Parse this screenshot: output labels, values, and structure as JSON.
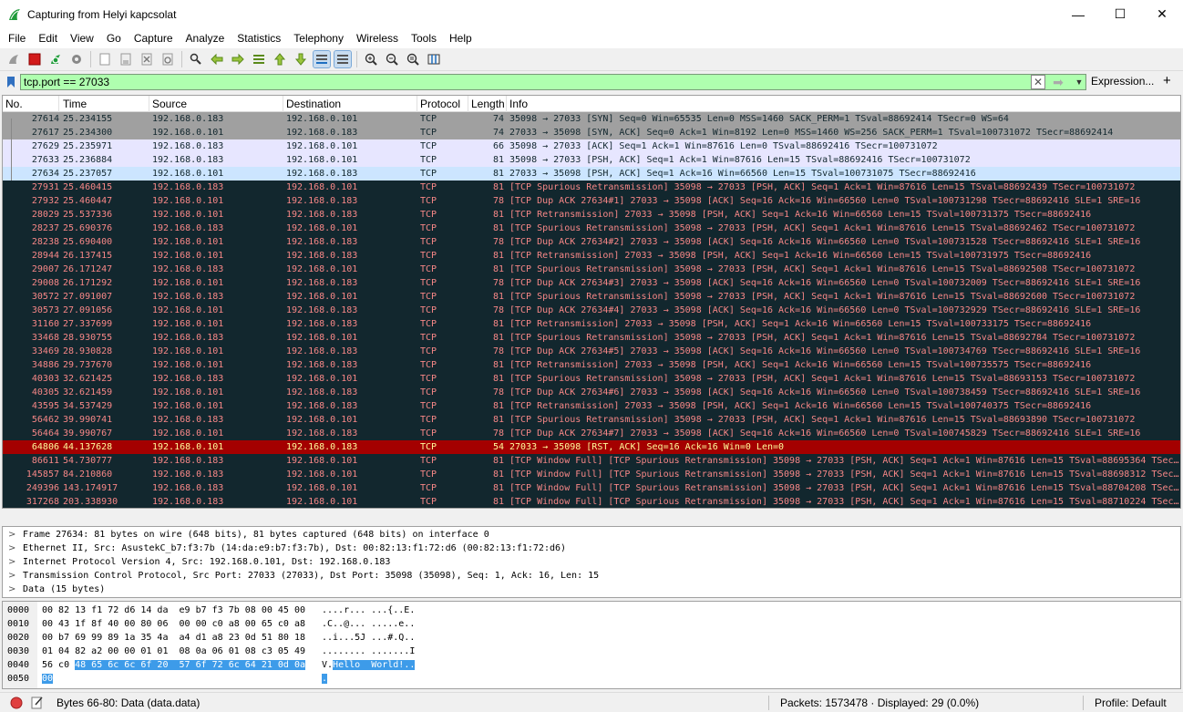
{
  "window": {
    "title": "Capturing from Helyi kapcsolat",
    "minimize": "—",
    "maximize": "☐",
    "close": "✕"
  },
  "menu": [
    "File",
    "Edit",
    "View",
    "Go",
    "Capture",
    "Analyze",
    "Statistics",
    "Telephony",
    "Wireless",
    "Tools",
    "Help"
  ],
  "filter": {
    "value": "tcp.port == 27033",
    "expression_label": "Expression...",
    "add_label": "+"
  },
  "packet_list": {
    "columns": [
      "No.",
      "Time",
      "Source",
      "Destination",
      "Protocol",
      "Length",
      "Info"
    ],
    "rows": [
      {
        "style": "gray",
        "no": "27614",
        "time": "25.234155",
        "src": "192.168.0.183",
        "dst": "192.168.0.101",
        "proto": "TCP",
        "len": "74",
        "info": "35098 → 27033 [SYN] Seq=0 Win=65535 Len=0 MSS=1460 SACK_PERM=1 TSval=88692414 TSecr=0 WS=64"
      },
      {
        "style": "gray",
        "no": "27617",
        "time": "25.234300",
        "src": "192.168.0.101",
        "dst": "192.168.0.183",
        "proto": "TCP",
        "len": "74",
        "info": "27033 → 35098 [SYN, ACK] Seq=0 Ack=1 Win=8192 Len=0 MSS=1460 WS=256 SACK_PERM=1 TSval=100731072 TSecr=88692414"
      },
      {
        "style": "lav",
        "no": "27629",
        "time": "25.235971",
        "src": "192.168.0.183",
        "dst": "192.168.0.101",
        "proto": "TCP",
        "len": "66",
        "info": "35098 → 27033 [ACK] Seq=1 Ack=1 Win=87616 Len=0 TSval=88692416 TSecr=100731072"
      },
      {
        "style": "lav",
        "no": "27633",
        "time": "25.236884",
        "src": "192.168.0.183",
        "dst": "192.168.0.101",
        "proto": "TCP",
        "len": "81",
        "info": "35098 → 27033 [PSH, ACK] Seq=1 Ack=1 Win=87616 Len=15 TSval=88692416 TSecr=100731072"
      },
      {
        "style": "sel",
        "no": "27634",
        "time": "25.237057",
        "src": "192.168.0.101",
        "dst": "192.168.0.183",
        "proto": "TCP",
        "len": "81",
        "info": "27033 → 35098 [PSH, ACK] Seq=1 Ack=16 Win=66560 Len=15 TSval=100731075 TSecr=88692416"
      },
      {
        "style": "dark",
        "no": "27931",
        "time": "25.460415",
        "src": "192.168.0.183",
        "dst": "192.168.0.101",
        "proto": "TCP",
        "len": "81",
        "info": "[TCP Spurious Retransmission] 35098 → 27033 [PSH, ACK] Seq=1 Ack=1 Win=87616 Len=15 TSval=88692439 TSecr=100731072"
      },
      {
        "style": "dark",
        "no": "27932",
        "time": "25.460447",
        "src": "192.168.0.101",
        "dst": "192.168.0.183",
        "proto": "TCP",
        "len": "78",
        "info": "[TCP Dup ACK 27634#1] 27033 → 35098 [ACK] Seq=16 Ack=16 Win=66560 Len=0 TSval=100731298 TSecr=88692416 SLE=1 SRE=16"
      },
      {
        "style": "dark",
        "no": "28029",
        "time": "25.537336",
        "src": "192.168.0.101",
        "dst": "192.168.0.183",
        "proto": "TCP",
        "len": "81",
        "info": "[TCP Retransmission] 27033 → 35098 [PSH, ACK] Seq=1 Ack=16 Win=66560 Len=15 TSval=100731375 TSecr=88692416"
      },
      {
        "style": "dark",
        "no": "28237",
        "time": "25.690376",
        "src": "192.168.0.183",
        "dst": "192.168.0.101",
        "proto": "TCP",
        "len": "81",
        "info": "[TCP Spurious Retransmission] 35098 → 27033 [PSH, ACK] Seq=1 Ack=1 Win=87616 Len=15 TSval=88692462 TSecr=100731072"
      },
      {
        "style": "dark",
        "no": "28238",
        "time": "25.690400",
        "src": "192.168.0.101",
        "dst": "192.168.0.183",
        "proto": "TCP",
        "len": "78",
        "info": "[TCP Dup ACK 27634#2] 27033 → 35098 [ACK] Seq=16 Ack=16 Win=66560 Len=0 TSval=100731528 TSecr=88692416 SLE=1 SRE=16"
      },
      {
        "style": "dark",
        "no": "28944",
        "time": "26.137415",
        "src": "192.168.0.101",
        "dst": "192.168.0.183",
        "proto": "TCP",
        "len": "81",
        "info": "[TCP Retransmission] 27033 → 35098 [PSH, ACK] Seq=1 Ack=16 Win=66560 Len=15 TSval=100731975 TSecr=88692416"
      },
      {
        "style": "dark",
        "no": "29007",
        "time": "26.171247",
        "src": "192.168.0.183",
        "dst": "192.168.0.101",
        "proto": "TCP",
        "len": "81",
        "info": "[TCP Spurious Retransmission] 35098 → 27033 [PSH, ACK] Seq=1 Ack=1 Win=87616 Len=15 TSval=88692508 TSecr=100731072"
      },
      {
        "style": "dark",
        "no": "29008",
        "time": "26.171292",
        "src": "192.168.0.101",
        "dst": "192.168.0.183",
        "proto": "TCP",
        "len": "78",
        "info": "[TCP Dup ACK 27634#3] 27033 → 35098 [ACK] Seq=16 Ack=16 Win=66560 Len=0 TSval=100732009 TSecr=88692416 SLE=1 SRE=16"
      },
      {
        "style": "dark",
        "no": "30572",
        "time": "27.091007",
        "src": "192.168.0.183",
        "dst": "192.168.0.101",
        "proto": "TCP",
        "len": "81",
        "info": "[TCP Spurious Retransmission] 35098 → 27033 [PSH, ACK] Seq=1 Ack=1 Win=87616 Len=15 TSval=88692600 TSecr=100731072"
      },
      {
        "style": "dark",
        "no": "30573",
        "time": "27.091056",
        "src": "192.168.0.101",
        "dst": "192.168.0.183",
        "proto": "TCP",
        "len": "78",
        "info": "[TCP Dup ACK 27634#4] 27033 → 35098 [ACK] Seq=16 Ack=16 Win=66560 Len=0 TSval=100732929 TSecr=88692416 SLE=1 SRE=16"
      },
      {
        "style": "dark",
        "no": "31160",
        "time": "27.337699",
        "src": "192.168.0.101",
        "dst": "192.168.0.183",
        "proto": "TCP",
        "len": "81",
        "info": "[TCP Retransmission] 27033 → 35098 [PSH, ACK] Seq=1 Ack=16 Win=66560 Len=15 TSval=100733175 TSecr=88692416"
      },
      {
        "style": "dark",
        "no": "33468",
        "time": "28.930755",
        "src": "192.168.0.183",
        "dst": "192.168.0.101",
        "proto": "TCP",
        "len": "81",
        "info": "[TCP Spurious Retransmission] 35098 → 27033 [PSH, ACK] Seq=1 Ack=1 Win=87616 Len=15 TSval=88692784 TSecr=100731072"
      },
      {
        "style": "dark",
        "no": "33469",
        "time": "28.930828",
        "src": "192.168.0.101",
        "dst": "192.168.0.183",
        "proto": "TCP",
        "len": "78",
        "info": "[TCP Dup ACK 27634#5] 27033 → 35098 [ACK] Seq=16 Ack=16 Win=66560 Len=0 TSval=100734769 TSecr=88692416 SLE=1 SRE=16"
      },
      {
        "style": "dark",
        "no": "34886",
        "time": "29.737670",
        "src": "192.168.0.101",
        "dst": "192.168.0.183",
        "proto": "TCP",
        "len": "81",
        "info": "[TCP Retransmission] 27033 → 35098 [PSH, ACK] Seq=1 Ack=16 Win=66560 Len=15 TSval=100735575 TSecr=88692416"
      },
      {
        "style": "dark",
        "no": "40303",
        "time": "32.621425",
        "src": "192.168.0.183",
        "dst": "192.168.0.101",
        "proto": "TCP",
        "len": "81",
        "info": "[TCP Spurious Retransmission] 35098 → 27033 [PSH, ACK] Seq=1 Ack=1 Win=87616 Len=15 TSval=88693153 TSecr=100731072"
      },
      {
        "style": "dark",
        "no": "40305",
        "time": "32.621459",
        "src": "192.168.0.101",
        "dst": "192.168.0.183",
        "proto": "TCP",
        "len": "78",
        "info": "[TCP Dup ACK 27634#6] 27033 → 35098 [ACK] Seq=16 Ack=16 Win=66560 Len=0 TSval=100738459 TSecr=88692416 SLE=1 SRE=16"
      },
      {
        "style": "dark",
        "no": "43595",
        "time": "34.537429",
        "src": "192.168.0.101",
        "dst": "192.168.0.183",
        "proto": "TCP",
        "len": "81",
        "info": "[TCP Retransmission] 27033 → 35098 [PSH, ACK] Seq=1 Ack=16 Win=66560 Len=15 TSval=100740375 TSecr=88692416"
      },
      {
        "style": "dark",
        "no": "56462",
        "time": "39.990741",
        "src": "192.168.0.183",
        "dst": "192.168.0.101",
        "proto": "TCP",
        "len": "81",
        "info": "[TCP Spurious Retransmission] 35098 → 27033 [PSH, ACK] Seq=1 Ack=1 Win=87616 Len=15 TSval=88693890 TSecr=100731072"
      },
      {
        "style": "dark",
        "no": "56464",
        "time": "39.990767",
        "src": "192.168.0.101",
        "dst": "192.168.0.183",
        "proto": "TCP",
        "len": "78",
        "info": "[TCP Dup ACK 27634#7] 27033 → 35098 [ACK] Seq=16 Ack=16 Win=66560 Len=0 TSval=100745829 TSecr=88692416 SLE=1 SRE=16"
      },
      {
        "style": "rst",
        "no": "64806",
        "time": "44.137628",
        "src": "192.168.0.101",
        "dst": "192.168.0.183",
        "proto": "TCP",
        "len": "54",
        "info": "27033 → 35098 [RST, ACK] Seq=16 Ack=16 Win=0 Len=0"
      },
      {
        "style": "dark",
        "no": "86611",
        "time": "54.730777",
        "src": "192.168.0.183",
        "dst": "192.168.0.101",
        "proto": "TCP",
        "len": "81",
        "info": "[TCP Window Full] [TCP Spurious Retransmission] 35098 → 27033 [PSH, ACK] Seq=1 Ack=1 Win=87616 Len=15 TSval=88695364 TSec…"
      },
      {
        "style": "dark",
        "no": "145857",
        "time": "84.210860",
        "src": "192.168.0.183",
        "dst": "192.168.0.101",
        "proto": "TCP",
        "len": "81",
        "info": "[TCP Window Full] [TCP Spurious Retransmission] 35098 → 27033 [PSH, ACK] Seq=1 Ack=1 Win=87616 Len=15 TSval=88698312 TSec…"
      },
      {
        "style": "dark",
        "no": "249396",
        "time": "143.174917",
        "src": "192.168.0.183",
        "dst": "192.168.0.101",
        "proto": "TCP",
        "len": "81",
        "info": "[TCP Window Full] [TCP Spurious Retransmission] 35098 → 27033 [PSH, ACK] Seq=1 Ack=1 Win=87616 Len=15 TSval=88704208 TSec…"
      },
      {
        "style": "dark",
        "no": "317268",
        "time": "203.338930",
        "src": "192.168.0.183",
        "dst": "192.168.0.101",
        "proto": "TCP",
        "len": "81",
        "info": "[TCP Window Full] [TCP Spurious Retransmission] 35098 → 27033 [PSH, ACK] Seq=1 Ack=1 Win=87616 Len=15 TSval=88710224 TSec…"
      }
    ]
  },
  "details": [
    "Frame 27634: 81 bytes on wire (648 bits), 81 bytes captured (648 bits) on interface 0",
    "Ethernet II, Src: AsustekC_b7:f3:7b (14:da:e9:b7:f3:7b), Dst: 00:82:13:f1:72:d6 (00:82:13:f1:72:d6)",
    "Internet Protocol Version 4, Src: 192.168.0.101, Dst: 192.168.0.183",
    "Transmission Control Protocol, Src Port: 27033 (27033), Dst Port: 35098 (35098), Seq: 1, Ack: 16, Len: 15",
    "Data (15 bytes)"
  ],
  "bytes": {
    "offsets": [
      "0000",
      "0010",
      "0020",
      "0030",
      "0040",
      "0050"
    ],
    "rows": [
      {
        "hex": "00 82 13 f1 72 d6 14 da  e9 b7 f3 7b 08 00 45 00",
        "hex_hl": "",
        "ascii": "....r... ...{..E.",
        "ascii_hl": ""
      },
      {
        "hex": "00 43 1f 8f 40 00 80 06  00 00 c0 a8 00 65 c0 a8",
        "hex_hl": "",
        "ascii": ".C..@... .....e..",
        "ascii_hl": ""
      },
      {
        "hex": "00 b7 69 99 89 1a 35 4a  a4 d1 a8 23 0d 51 80 18",
        "hex_hl": "",
        "ascii": "..i...5J ...#.Q..",
        "ascii_hl": ""
      },
      {
        "hex": "01 04 82 a2 00 00 01 01  08 0a 06 01 08 c3 05 49",
        "hex_hl": "",
        "ascii": "........ .......I",
        "ascii_hl": ""
      },
      {
        "hex": "56 c0 ",
        "hex_hl": "48 65 6c 6c 6f 20  57 6f 72 6c 64 21 0d 0a",
        "ascii": "V.",
        "ascii_hl": "Hello  World!.."
      },
      {
        "hex": "",
        "hex_hl": "00",
        "ascii": "",
        "ascii_hl": "."
      }
    ]
  },
  "status": {
    "bytes_info": "Bytes 66-80: Data (data.data)",
    "packets": "Packets: 1573478 · Displayed: 29 (0.0%)",
    "profile": "Profile: Default"
  },
  "colors": {
    "filter_bg": "#afffaf",
    "dark_row_bg": "#12272e",
    "dark_row_fg": "#f78787",
    "rst_row_bg": "#a40000",
    "rst_row_fg": "#fffc9c",
    "selected_row_bg": "#cce5ff",
    "bytes_highlight": "#3d9be9"
  }
}
